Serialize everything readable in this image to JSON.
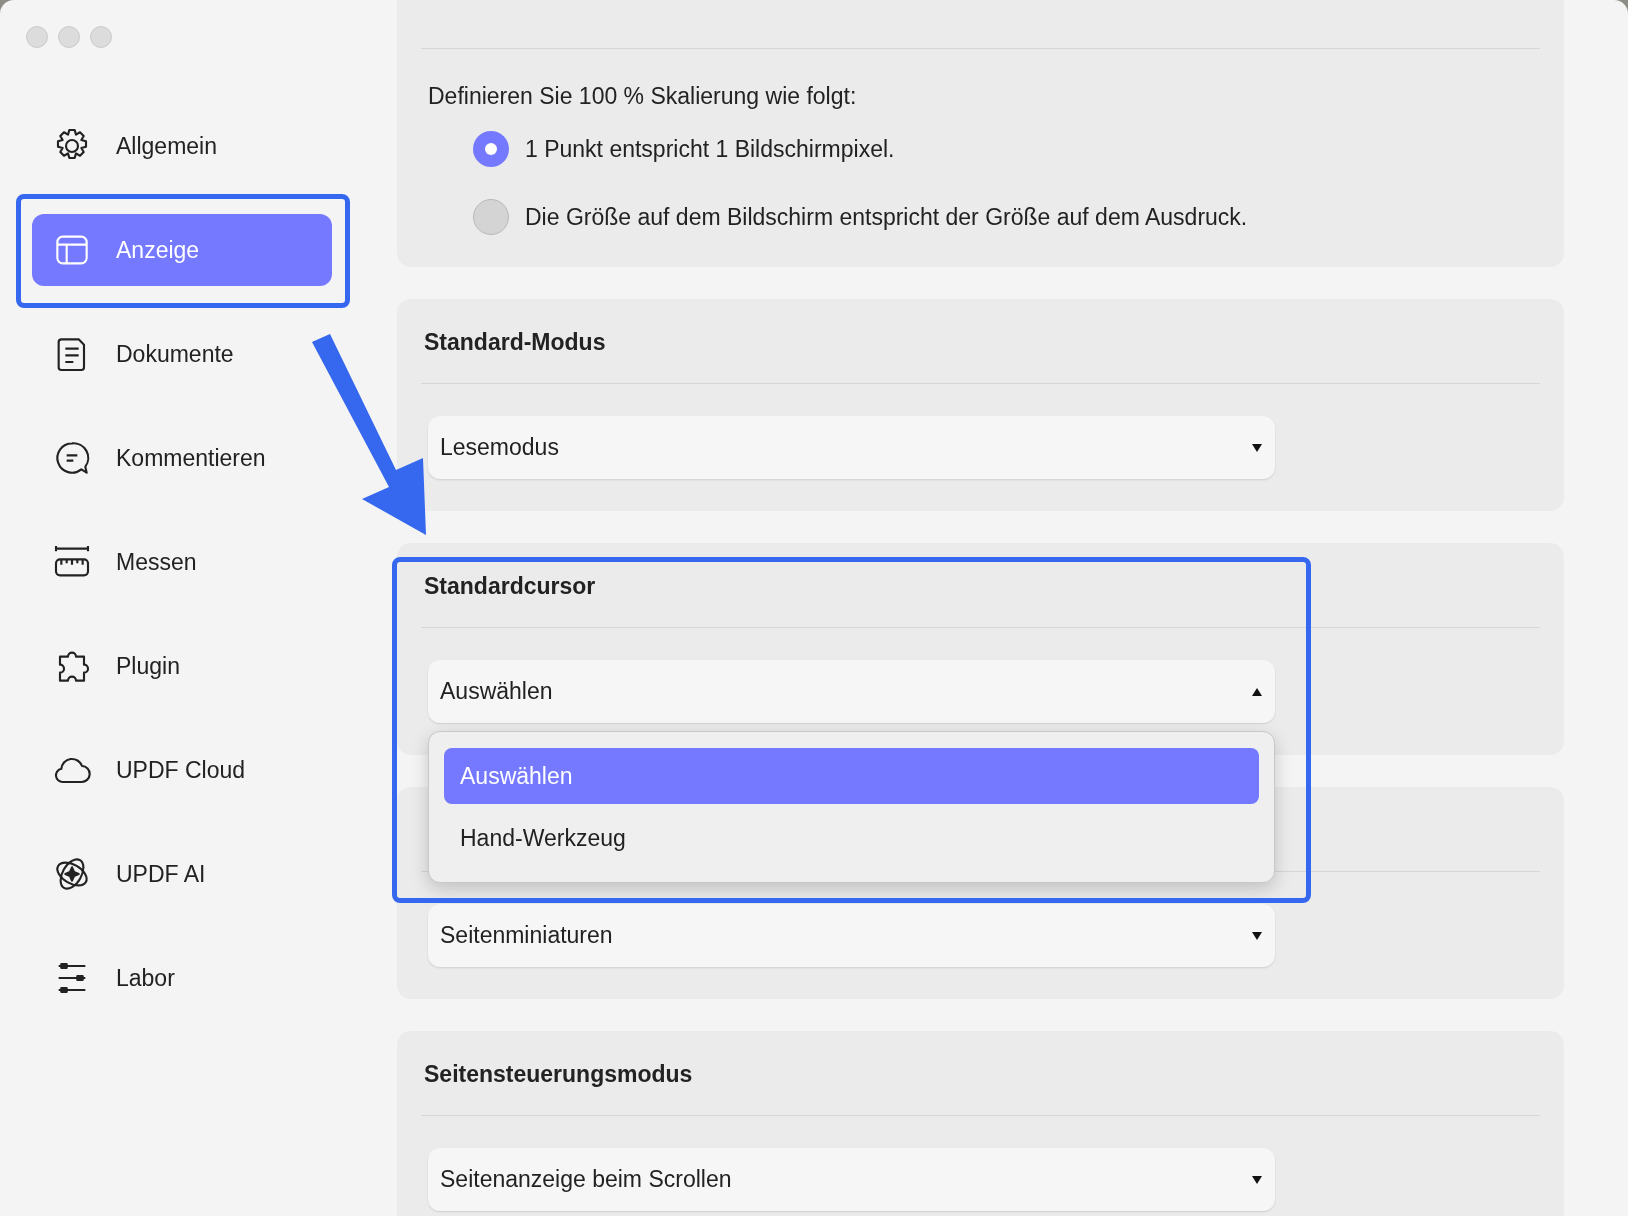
{
  "sidebar": {
    "items": [
      {
        "label": "Allgemein",
        "selected": false
      },
      {
        "label": "Anzeige",
        "selected": true
      },
      {
        "label": "Dokumente",
        "selected": false
      },
      {
        "label": "Kommentieren",
        "selected": false
      },
      {
        "label": "Messen",
        "selected": false
      },
      {
        "label": "Plugin",
        "selected": false
      },
      {
        "label": "UPDF Cloud",
        "selected": false
      },
      {
        "label": "UPDF AI",
        "selected": false
      },
      {
        "label": "Labor",
        "selected": false
      }
    ]
  },
  "sections": [
    {
      "kind": "radio",
      "lead": "Definieren Sie 100 % Skalierung wie folgt:",
      "options": [
        {
          "label": "1 Punkt entspricht 1 Bildschirmpixel.",
          "selected": true
        },
        {
          "label": "Die Größe auf dem Bildschirm entspricht der Größe auf dem Ausdruck.",
          "selected": false
        }
      ]
    },
    {
      "kind": "select",
      "heading": "Standard-Modus",
      "value": "Lesemodus",
      "expanded": false
    },
    {
      "kind": "select",
      "heading": "Standardcursor",
      "value": "Auswählen",
      "expanded": true,
      "options": [
        {
          "label": "Auswählen",
          "selected": true
        },
        {
          "label": "Hand-Werkzeug",
          "selected": false
        }
      ]
    },
    {
      "kind": "select",
      "value": "Seitenminiaturen",
      "expanded": false
    },
    {
      "kind": "select",
      "heading": "Seitensteuerungsmodus",
      "value": "Seitenanzeige beim Scrollen",
      "expanded": false
    }
  ]
}
